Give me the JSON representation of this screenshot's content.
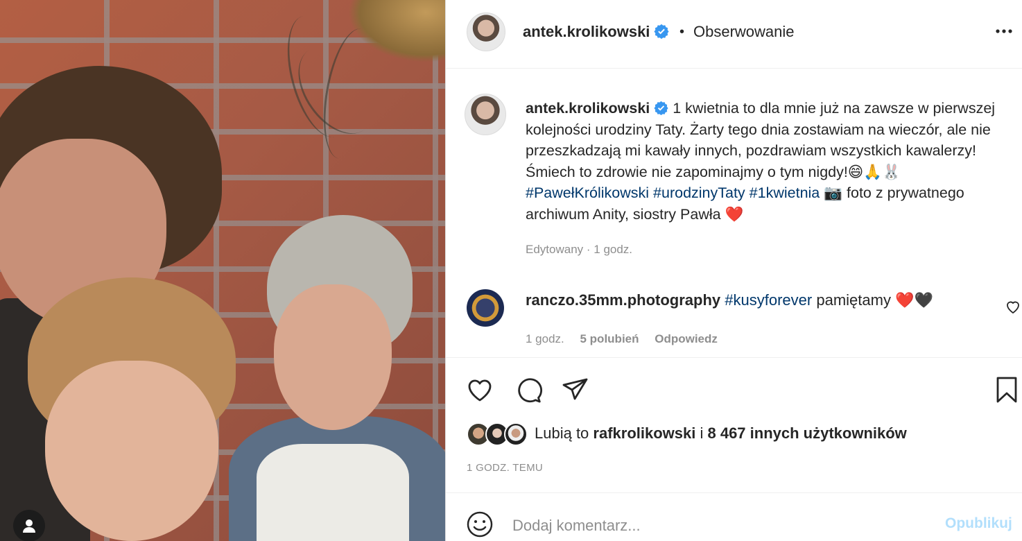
{
  "post": {
    "username": "antek.krolikowski",
    "follow_label": "Obserwowanie",
    "dot": "•"
  },
  "caption": {
    "username": "antek.krolikowski",
    "text1": " 1 kwietnia to dla mnie już na zawsze w pierwszej kolejności urodziny Taty. Żarty tego dnia zostawiam na wieczór, ale nie przeszkadzają mi kawały innych, pozdrawiam wszystkich kawalerzy! Śmiech to zdrowie nie zapominajmy o tym nigdy!",
    "emojis": "😄🙏🐰",
    "tag1": "#PawełKrólikowski",
    "tag2": "#urodzinyTaty",
    "tag3": "#1kwietnia",
    "camera": "📷",
    "text2": "foto z prywatnego archiwum Anity, siostry Pawła",
    "heart": "❤️",
    "meta": "Edytowany · 1 godz."
  },
  "comment": {
    "username": "ranczo.35mm.photography",
    "tag": "#kusyforever",
    "text": " pamiętamy ",
    "emojis": "❤️🖤",
    "time": "1 godz.",
    "likes": "5 polubień",
    "reply": "Odpowiedz"
  },
  "likes": {
    "prefix": "Lubią to ",
    "user": "rafkrolikowski",
    "middle": " i ",
    "count": "8 467 innych użytkowników"
  },
  "timeago": "1 GODZ. TEMU",
  "add_comment": {
    "placeholder": "Dodaj komentarz...",
    "publish_label": "Opublikuj"
  },
  "icons": {
    "verified": "verified-badge-icon",
    "more": "more-options-icon",
    "like": "heart-icon",
    "comment": "comment-icon",
    "share": "send-icon",
    "save": "bookmark-icon",
    "emoji": "emoji-icon",
    "user_tag": "user-tag-icon"
  },
  "colors": {
    "verified": "#3897f0",
    "hashtag": "#00376b",
    "muted": "#8e8e8e",
    "publish_disabled": "#b2dffc"
  }
}
